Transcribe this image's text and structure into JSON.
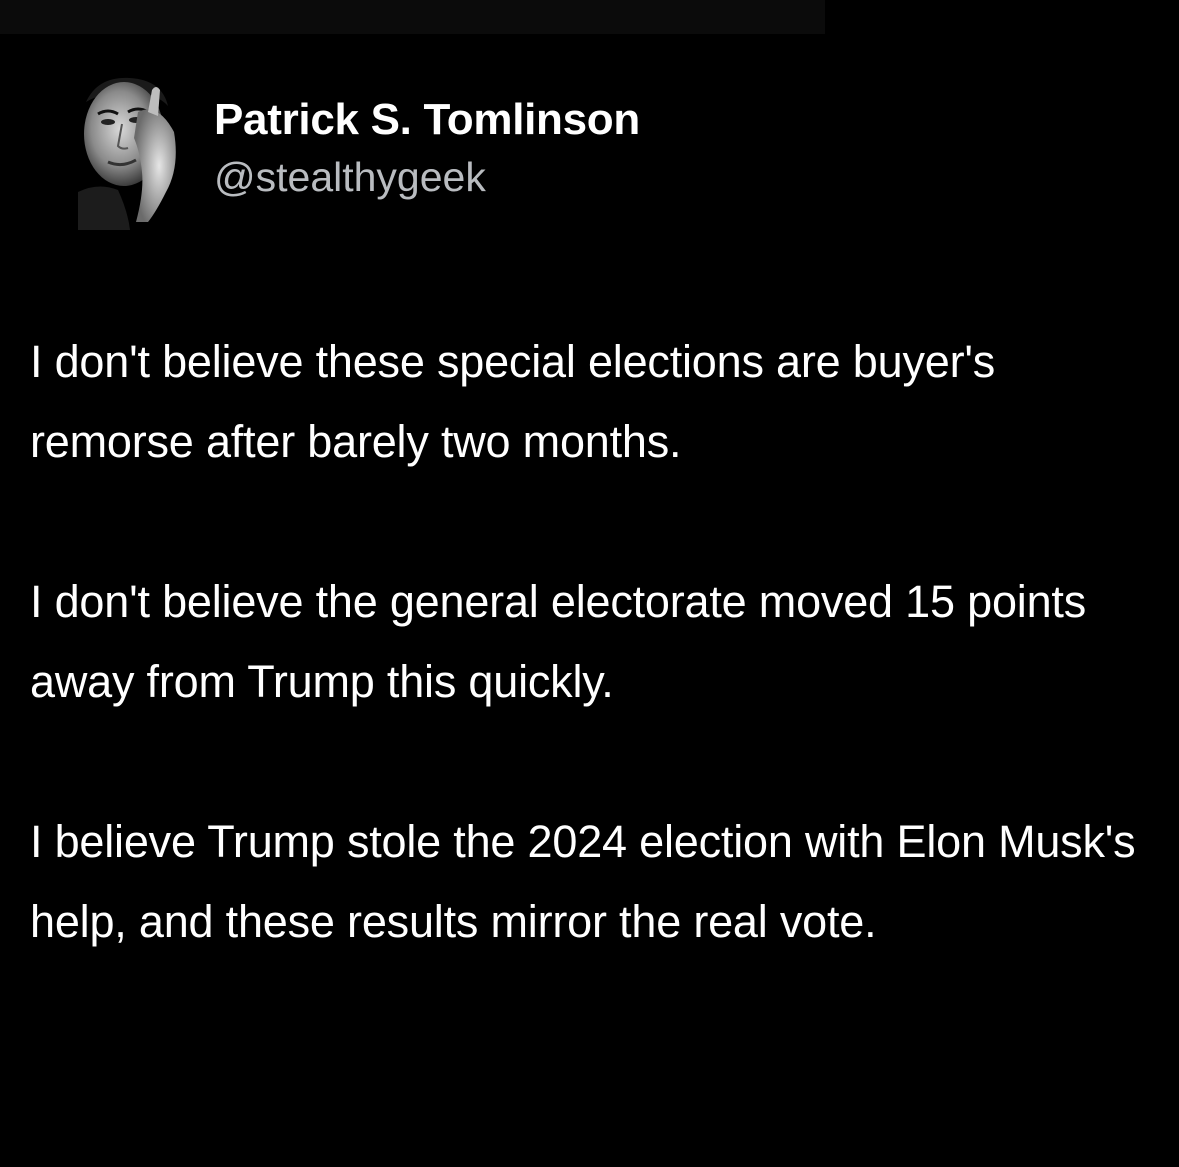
{
  "colors": {
    "background": "#000000",
    "text_primary": "#ffffff",
    "text_secondary": "#b9bcc0"
  },
  "author": {
    "display_name": "Patrick S. Tomlinson",
    "handle": "@stealthygeek",
    "avatar_icon": "avatar-photo"
  },
  "tweet": {
    "paragraphs": [
      "I don't believe these special elections are buyer's remorse after barely two months.",
      "I don't believe the general electorate moved 15 points away from Trump this quickly.",
      "I believe Trump stole the 2024 election with Elon Musk's help, and these results mirror the real vote."
    ]
  }
}
